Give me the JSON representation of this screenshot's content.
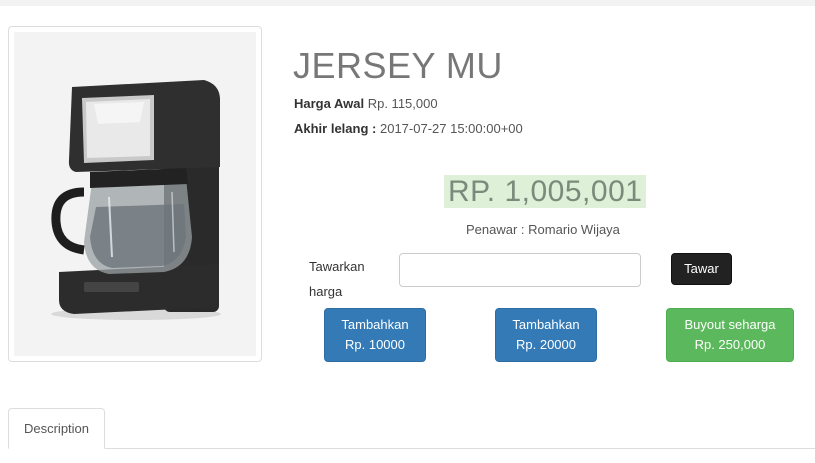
{
  "product": {
    "title": "JERSEY MU",
    "image_alt": "coffee-maker",
    "start_price_label": "Harga Awal",
    "start_price_value": "Rp. 115,000",
    "end_label": "Akhir lelang :",
    "end_value": "2017-07-27 15:00:00+00"
  },
  "bid": {
    "current_price": "RP. 1,005,001",
    "bidder_label": "Penawar :",
    "bidder_name": "Romario Wijaya",
    "offer_label_line1": "Tawarkan",
    "offer_label_line2": "harga",
    "offer_input_value": "",
    "submit_label": "Tawar"
  },
  "quick_buttons": [
    {
      "line1": "Tambahkan",
      "line2": "Rp. 10000"
    },
    {
      "line1": "Tambahkan",
      "line2": "Rp. 20000"
    },
    {
      "line1": "Buyout seharga",
      "line2": "Rp. 250,000"
    }
  ],
  "tabs": [
    {
      "label": "Description"
    }
  ],
  "colors": {
    "primary": "#337ab7",
    "success": "#5cb85c",
    "dark": "#222222",
    "price_bg": "#dff0d8"
  }
}
